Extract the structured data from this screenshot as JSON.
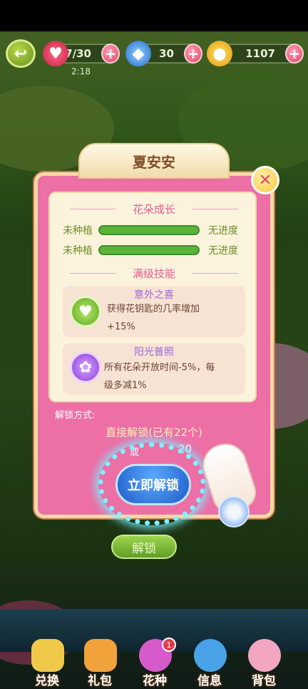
{
  "hud": {
    "hearts": "27/30",
    "timer": "2:18",
    "gems": "30",
    "coins": "1107",
    "plus": "+"
  },
  "dialog": {
    "title": "夏安安",
    "close": "✕",
    "growth_title": "花朵成长",
    "rows": [
      {
        "label": "未种植",
        "status": "无进度"
      },
      {
        "label": "未种植",
        "status": "无进度"
      }
    ],
    "skills_title": "满级技能",
    "skills": [
      {
        "name": "意外之喜",
        "desc_line1": "获得花钥匙的几率增加",
        "desc_line2": "+15%"
      },
      {
        "name": "阳光普照",
        "desc_line1": "所有花朵开放时间-5%，每",
        "desc_line2": "级多减1%"
      }
    ],
    "unlock_label": "解锁方式:",
    "direct_unlock": "直接解锁(已有22个)",
    "or_text": "或",
    "or_cost": "20",
    "unlock_now": "立即解锁"
  },
  "behind": {
    "unlock_button": "解锁"
  },
  "nav": [
    {
      "label": "兑换",
      "color": "#f0c84a"
    },
    {
      "label": "礼包",
      "color": "#f2a23a"
    },
    {
      "label": "花种",
      "color": "#d75acb",
      "badge": "1"
    },
    {
      "label": "信息",
      "color": "#4aa3e8"
    },
    {
      "label": "背包",
      "color": "#f3a6c2"
    }
  ]
}
